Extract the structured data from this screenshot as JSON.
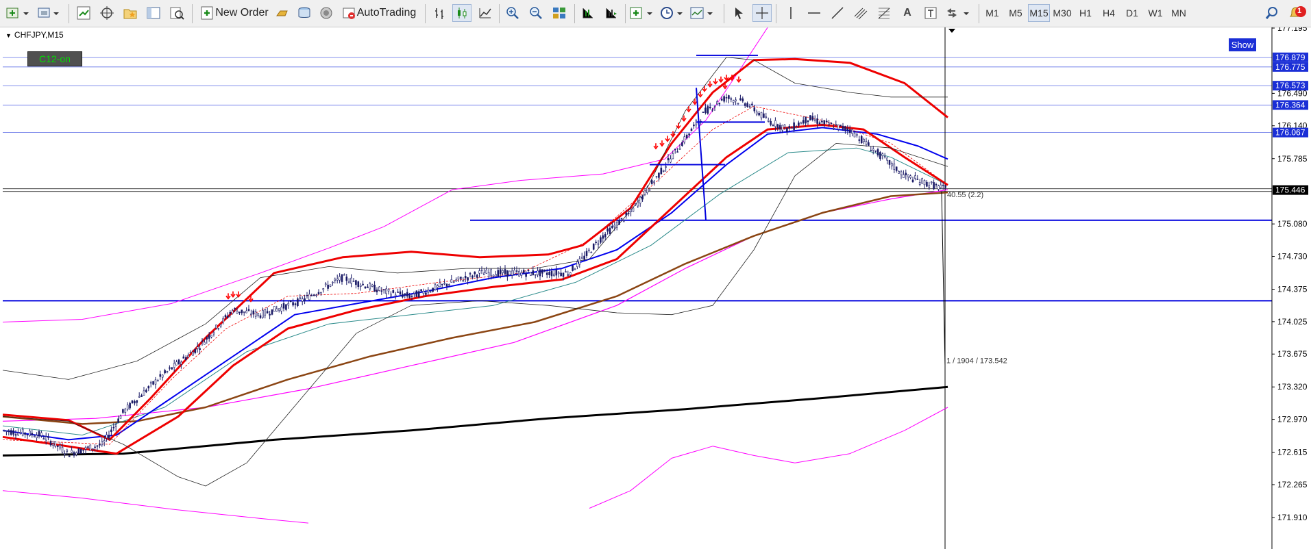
{
  "toolbar": {
    "new_order_label": "New Order",
    "autotrading_label": "AutoTrading",
    "timeframes": [
      "M1",
      "M5",
      "M15",
      "M30",
      "H1",
      "H4",
      "D1",
      "W1",
      "MN"
    ],
    "active_timeframe": "M15",
    "notification_count": "1"
  },
  "chart": {
    "symbol_label": "CHFJPY,M15",
    "badge_label": "C12-on",
    "show_button_label": "Show",
    "current_price": "175.446",
    "measure_label": "40.55 (2.2)",
    "crosshair_label": "1 / 1904 / 173.542",
    "price_ticks": [
      "177.195",
      "176.490",
      "176.140",
      "175.785",
      "175.080",
      "174.730",
      "174.375",
      "174.025",
      "173.675",
      "173.320",
      "172.970",
      "172.615",
      "172.265",
      "171.910"
    ],
    "level_tags": [
      "176.879",
      "176.775",
      "176.573",
      "176.364",
      "176.067"
    ],
    "colors": {
      "background": "#ffffff",
      "candles": "#1a1a66",
      "level_lines": "#0000dd",
      "ma_red": "#ee0000",
      "ma_blue": "#0000ee",
      "ma_brown": "#8b4513",
      "envelope": "#ff00ff",
      "arrows": "#ff0000"
    }
  }
}
